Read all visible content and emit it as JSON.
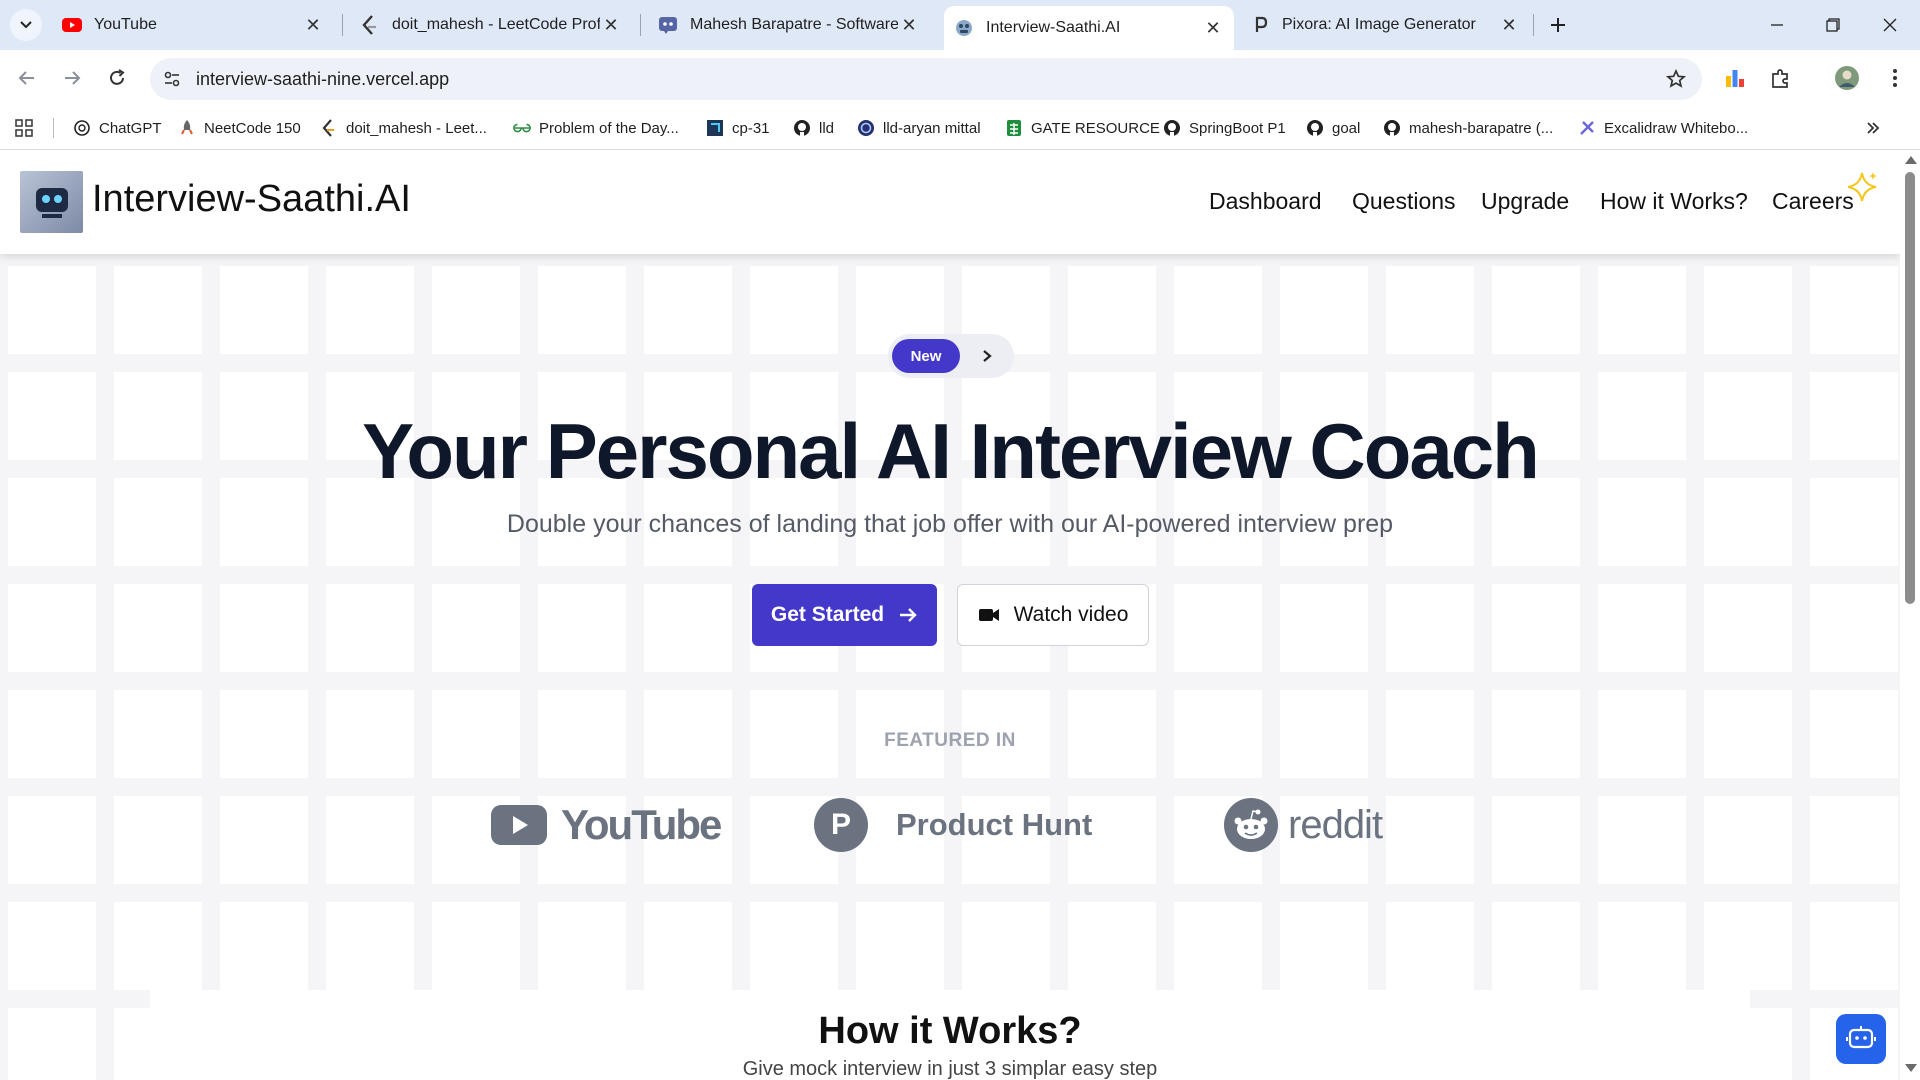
{
  "browser": {
    "tabs": [
      {
        "title": "YouTube",
        "icon": "youtube-icon",
        "active": false
      },
      {
        "title": "doit_mahesh - LeetCode Profile",
        "icon": "leetcode-icon",
        "active": false
      },
      {
        "title": "Mahesh Barapatre - Software Er",
        "icon": "discord-icon",
        "active": false
      },
      {
        "title": "Interview-Saathi.AI",
        "icon": "interview-saathi-icon",
        "active": true
      },
      {
        "title": "Pixora: AI Image Generator",
        "icon": "pixora-icon",
        "active": false
      }
    ],
    "url": "interview-saathi-nine.vercel.app",
    "bookmarks": [
      {
        "label": "ChatGPT",
        "icon": "chatgpt-icon"
      },
      {
        "label": "NeetCode 150",
        "icon": "rocket-icon"
      },
      {
        "label": "doit_mahesh - Leet...",
        "icon": "leetcode-icon"
      },
      {
        "label": "Problem of the Day...",
        "icon": "gfg-icon"
      },
      {
        "label": "cp-31",
        "icon": "cp31-icon"
      },
      {
        "label": "lld",
        "icon": "github-icon"
      },
      {
        "label": "lld-aryan mittal",
        "icon": "circle-logo-icon"
      },
      {
        "label": "GATE RESOURCE",
        "icon": "sheets-icon"
      },
      {
        "label": "SpringBoot P1",
        "icon": "github-icon"
      },
      {
        "label": "goal",
        "icon": "github-icon"
      },
      {
        "label": "mahesh-barapatre (...",
        "icon": "github-icon"
      },
      {
        "label": "Excalidraw Whitebo...",
        "icon": "excalidraw-icon"
      }
    ]
  },
  "site": {
    "brand": "Interview-Saathi.AI",
    "nav": [
      "Dashboard",
      "Questions",
      "Upgrade",
      "How it Works?",
      "Careers"
    ],
    "pill_label": "New",
    "headline": "Your Personal AI Interview Coach",
    "subheadline": "Double your chances of landing that job offer with our AI-powered interview prep",
    "cta_primary": "Get Started",
    "cta_secondary": "Watch video",
    "featured_label": "FEATURED IN",
    "featured": {
      "youtube": "YouTube",
      "producthunt_letter": "P",
      "producthunt": "Product Hunt",
      "reddit": "reddit"
    },
    "how_title": "How it Works?",
    "how_subtitle": "Give mock interview in just 3 simplar easy step"
  },
  "colors": {
    "accent": "#4338ca",
    "tabbar": "#dfe8f7",
    "page_bg": "#f5f5f7",
    "chat_fab": "#2563eb"
  }
}
